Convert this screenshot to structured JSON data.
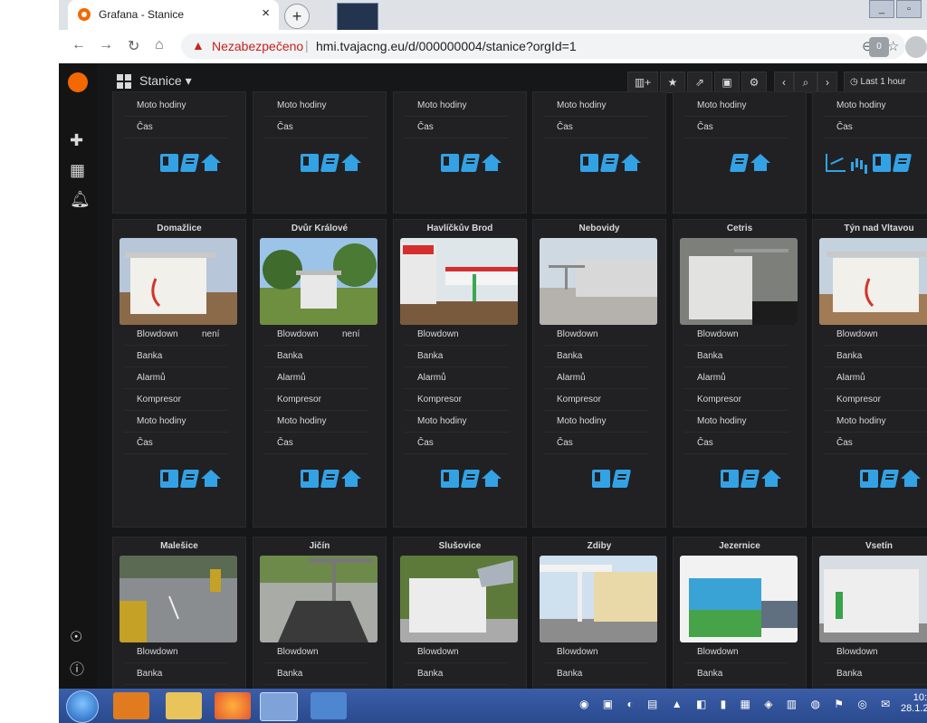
{
  "browser": {
    "tab_title": "Grafana - Stanice",
    "tab_close": "×",
    "new_tab": "+",
    "insecure_label": "Nezabezpečeno",
    "separator": "|",
    "url": "hmi.tvajacng.eu/d/000000004/stanice?orgId=1",
    "ext_badge": "0"
  },
  "dashboard": {
    "title": "Stanice",
    "title_caret": "▾",
    "time_range": "Last 1 hour"
  },
  "rows": {
    "blowdown": "Blowdown",
    "banka": "Banka",
    "alarmu": "Alarmů",
    "kompresor": "Kompresor",
    "moto": "Moto hodiny",
    "cas": "Čas",
    "neni": "není"
  },
  "panels_row2": [
    {
      "title": "Domažlice",
      "blowdown_value": "není"
    },
    {
      "title": "Dvůr Králové",
      "blowdown_value": "není"
    },
    {
      "title": "Havlíčkův Brod",
      "blowdown_value": ""
    },
    {
      "title": "Nebovidy",
      "blowdown_value": ""
    },
    {
      "title": "Cetris",
      "blowdown_value": ""
    },
    {
      "title": "Týn nad Vltavou",
      "blowdown_value": ""
    }
  ],
  "panels_row3": [
    {
      "title": "Malešice"
    },
    {
      "title": "Jičín"
    },
    {
      "title": "Slušovice"
    },
    {
      "title": "Zdiby"
    },
    {
      "title": "Jezernice"
    },
    {
      "title": "Vsetín"
    }
  ],
  "clock": {
    "time": "10:",
    "date": "28.1.2"
  },
  "colors": {
    "accent": "#33a2e5",
    "panel_bg": "#212124",
    "page_bg": "#161719"
  }
}
